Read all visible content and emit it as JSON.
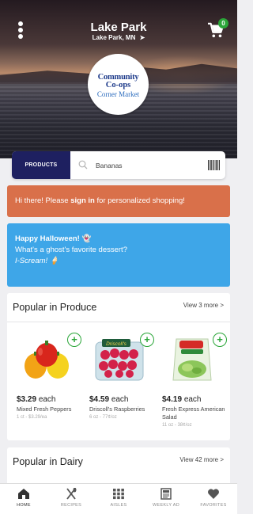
{
  "header": {
    "store_name": "Lake Park",
    "store_location": "Lake Park, MN",
    "cart_count": "0",
    "logo": {
      "line1": "Community",
      "line2": "Co-ops",
      "line3": "Corner Market"
    }
  },
  "search": {
    "products_label": "PRODUCTS",
    "query": "Bananas"
  },
  "greeting": {
    "prefix": "Hi there! Please ",
    "link": "sign in",
    "suffix": " for personalized shopping!"
  },
  "promo": {
    "heading": "Happy Halloween! 👻",
    "line2": "What's a ghost's favorite dessert?",
    "line3": "I-Scream! 🍦"
  },
  "produce": {
    "title": "Popular in Produce",
    "more": "View 3 more >",
    "products": [
      {
        "price": "$3.29",
        "unit_word": "each",
        "name": "Mixed Fresh Peppers",
        "unit": "1 ct - $3.29/ea"
      },
      {
        "price": "$4.59",
        "unit_word": "each",
        "name": "Driscoll's Raspberries",
        "unit": "6 oz - 77¢/oz"
      },
      {
        "price": "$4.19",
        "unit_word": "each",
        "name": "Fresh Express American Salad",
        "unit": "11 oz - 38¢/oz"
      }
    ]
  },
  "dairy": {
    "title": "Popular in Dairy",
    "more": "View 42 more >"
  },
  "tabs": [
    {
      "label": "HOME",
      "icon": "home-icon"
    },
    {
      "label": "RECIPES",
      "icon": "utensils-icon"
    },
    {
      "label": "AISLES",
      "icon": "grid-icon"
    },
    {
      "label": "WEEKLY AD",
      "icon": "newspaper-icon"
    },
    {
      "label": "FAVORITES",
      "icon": "heart-icon"
    }
  ],
  "colors": {
    "navy": "#1e2060",
    "orange_banner": "#d9704a",
    "blue_banner": "#3ea6e8",
    "green_accent": "#2aa638"
  }
}
